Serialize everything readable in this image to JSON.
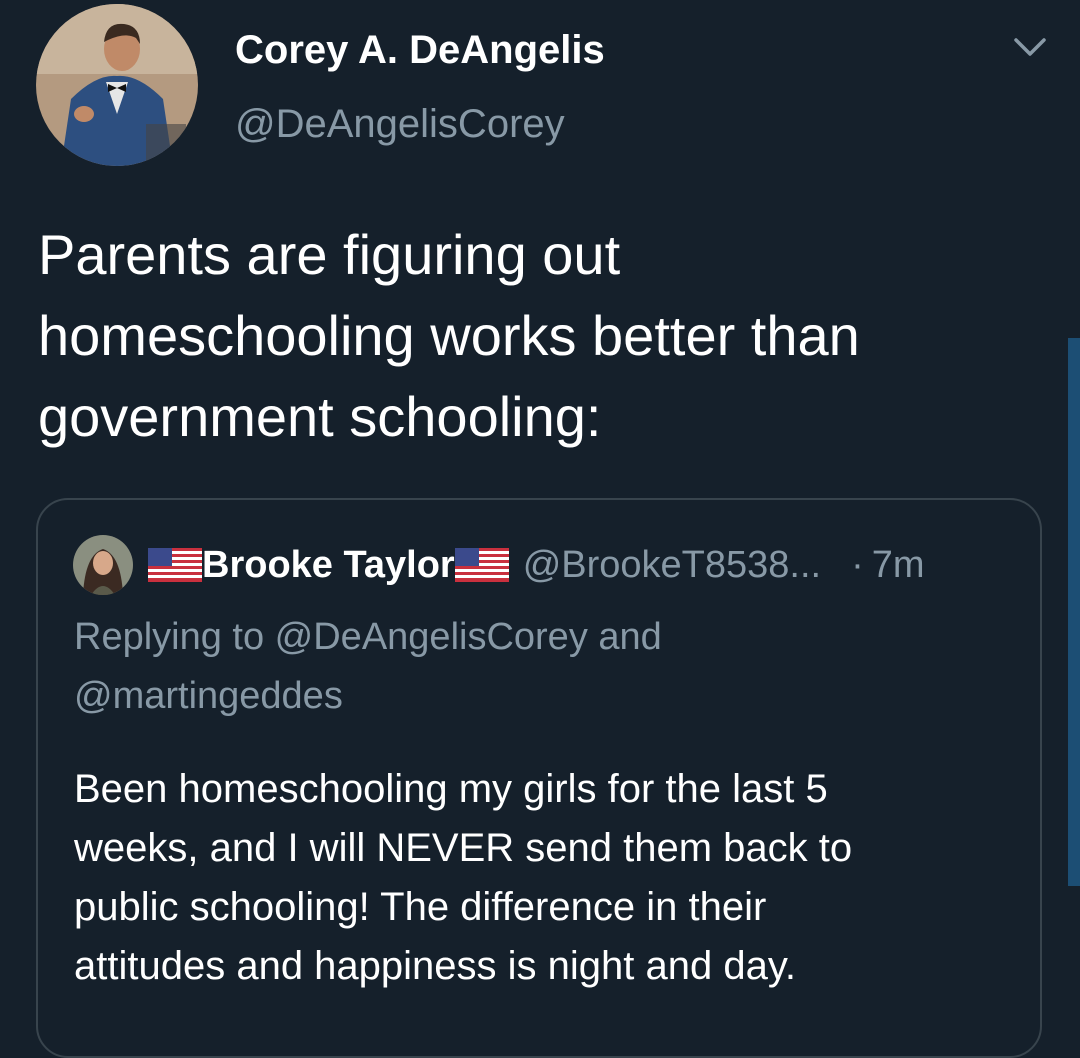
{
  "tweet": {
    "author": {
      "name": "Corey A. DeAngelis",
      "handle": "@DeAngelisCorey",
      "avatar_icon": "profile-photo"
    },
    "more_icon": "chevron-down-icon",
    "text_lines": [
      "Parents are figuring out",
      "homeschooling works better than",
      "government schooling:"
    ]
  },
  "quote": {
    "author": {
      "name": "Brooke Taylor",
      "flag_icon": "us-flag-icon",
      "handle": "@BrookeT8538...",
      "separator": "·",
      "time": "7m"
    },
    "replying_lines": [
      "Replying to @DeAngelisCorey and",
      "@martingeddes"
    ],
    "body_lines": [
      "Been homeschooling my girls for the last 5",
      "weeks, and I will NEVER send them back to",
      "public schooling! The difference in their",
      "attitudes and happiness is night and day."
    ]
  },
  "colors": {
    "background": "#15202b",
    "primary_text": "#ffffff",
    "secondary_text": "#8899a6",
    "card_border": "#38444d"
  }
}
